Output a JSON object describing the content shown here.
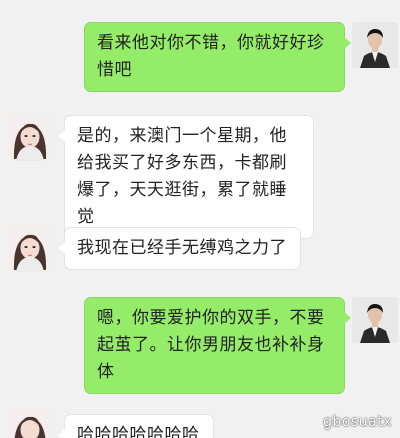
{
  "messages": [
    {
      "side": "sent",
      "text": "看来他对你不错，你就好好珍惜吧"
    },
    {
      "side": "received",
      "text": "是的，来澳门一个星期，他给我买了好多东西，卡都刷爆了，天天逛街，累了就睡觉"
    },
    {
      "side": "received",
      "text": "我现在已经手无缚鸡之力了"
    },
    {
      "side": "sent",
      "text": "嗯，你要爱护你的双手，不要起茧了。让你男朋友也补补身体"
    },
    {
      "side": "received",
      "text": "哈哈哈哈哈哈哈"
    }
  ],
  "watermark": "gbosuatx",
  "colors": {
    "background": "#f1f1f1",
    "sent_bubble": "#95ec69",
    "received_bubble": "#ffffff"
  }
}
